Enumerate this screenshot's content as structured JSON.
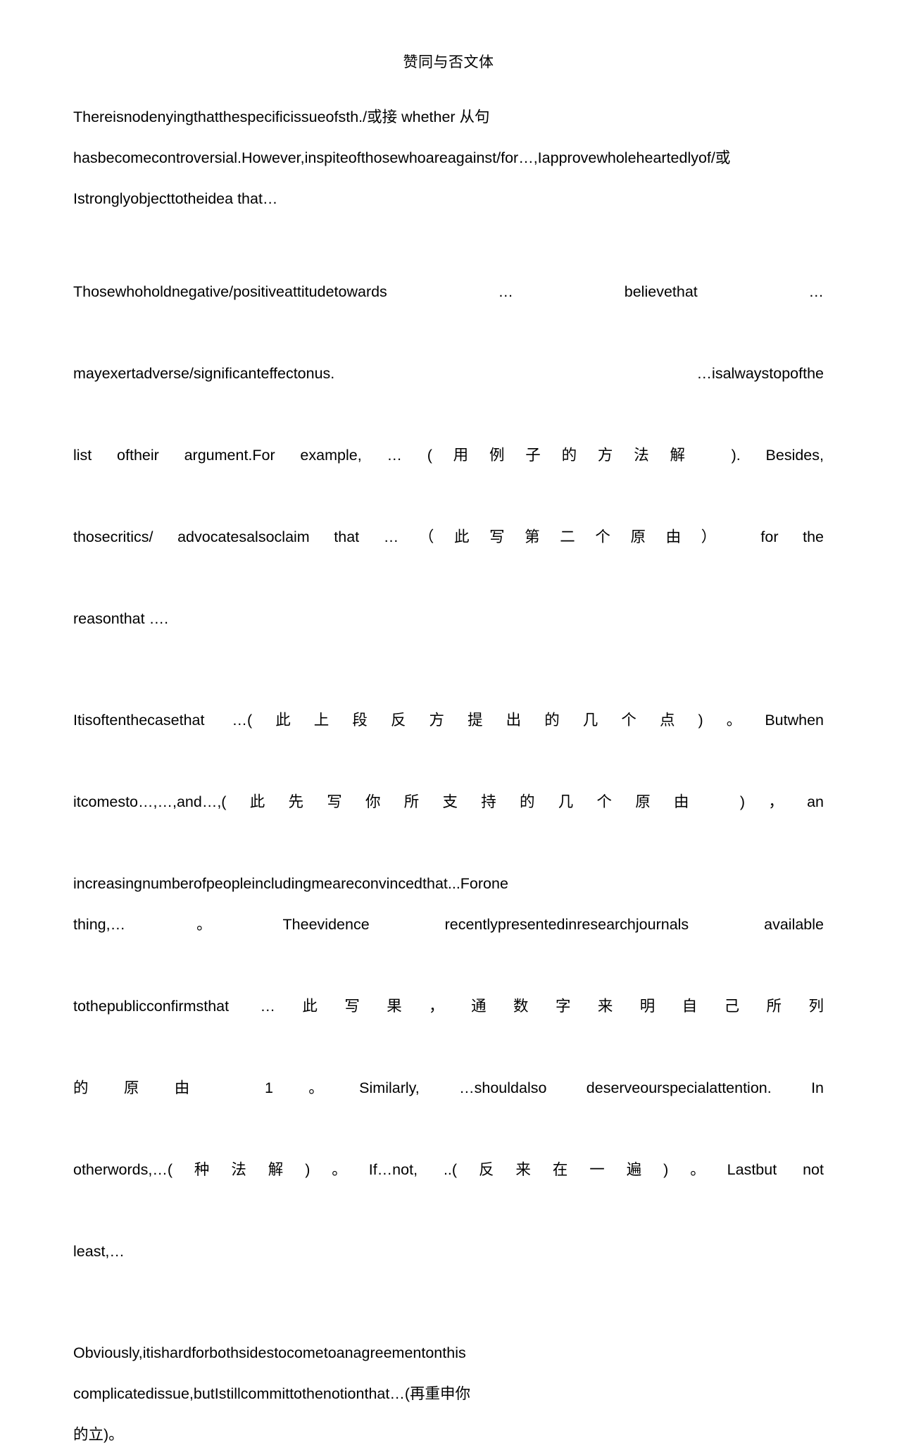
{
  "document": {
    "title": "赞同与否文体",
    "paragraphs": [
      {
        "id": "para-1",
        "align": "left",
        "text": "Thereisnodenyingthatthespecificissueofsth./或接 whether 从句 hasbecomecontroversial.However,inspiteofthosewhoareagainst/for…,Iapprovewholeheartedlyof/或 Istronglyobjecttotheidea that…"
      },
      {
        "id": "para-2",
        "align": "justify",
        "text": "Thosewhoholdnegative/positiveattitudetowards              …  believethat           … mayexertadverse/significanteffectonus.                    …isalwaystopofthe list    oftheir     argument.For      example, …（用例子的方法解            ).  Besides, thosecritics/        advocatesalsoclaim     that  …（此写第二个原由）      for  the reasonthat      ….",
        "lines": [
          "Thosewhoholdnegative/positiveattitudetowards                …  believethat         …",
          "mayexertadverse/significanteffectonus.                          …isalwaystopofthe",
          "list     oftheir     argument.For       example, … (用例子的方法解              ).   Besides,",
          "thosecritics/          advocatesalsoclaim      that   …（此写第二个原由）        for   the",
          "reasonthat      …."
        ]
      },
      {
        "id": "para-3",
        "align": "justify",
        "text": "Itisoftenthecasethat                    …(此上段反方提出的几个点)。Butwhen itcomesto…,…,and…,(此先写你所支持的几个原由                    )，an increasingnumberofpeopleincludingmeareconvincedthat...Forone thing,…。Theevidence      recentlypresentedinresearchjournals        available tothepublicconfirmsthat                …此写果，通数字来明自己所列 的原由 1。Similarly,        …shouldalso     deserveourspecialattention.        In otherwords,…(种法解)。If…not,                ..(反来在一遍)。Lastbut        not least,…",
        "lines": [
          "Itisoftenthecasethat                       …(此上段反方提出的几个点)。Butwhen",
          "itcomesto…,…,and…,(此先写你所支持的几个原由                           )，an",
          "increasingnumberofpeopleincludingmeareconvincedthat...Forone",
          "thing,…。Theevidence        recentlypresentedinresearchjournals          available",
          "tothepublicconfirmsthat                    …此写果，通数字来明自己所列",
          "的原由 1。Similarly,         …shouldalso      deserveourspecialattention.          In",
          "otherwords,…(种法解)。If…not,                  ..(反来在一遍)。Lastbut          not",
          "least,…"
        ]
      },
      {
        "id": "para-4",
        "align": "left",
        "text": "Obviously,itishardforbothsidestocometoanagreementonthis complicatedissue,butIstillcommittothenotionthat…(再重申你的立)。",
        "lines": [
          "Obviously,itishardforbothsidestocometoanagreementonthis",
          "complicatedissue,butIstillcommittothenotionthat…(再重申你",
          "的立)。"
        ]
      }
    ]
  },
  "colors": {
    "page_background": "#ffffff",
    "text": "#000000"
  }
}
